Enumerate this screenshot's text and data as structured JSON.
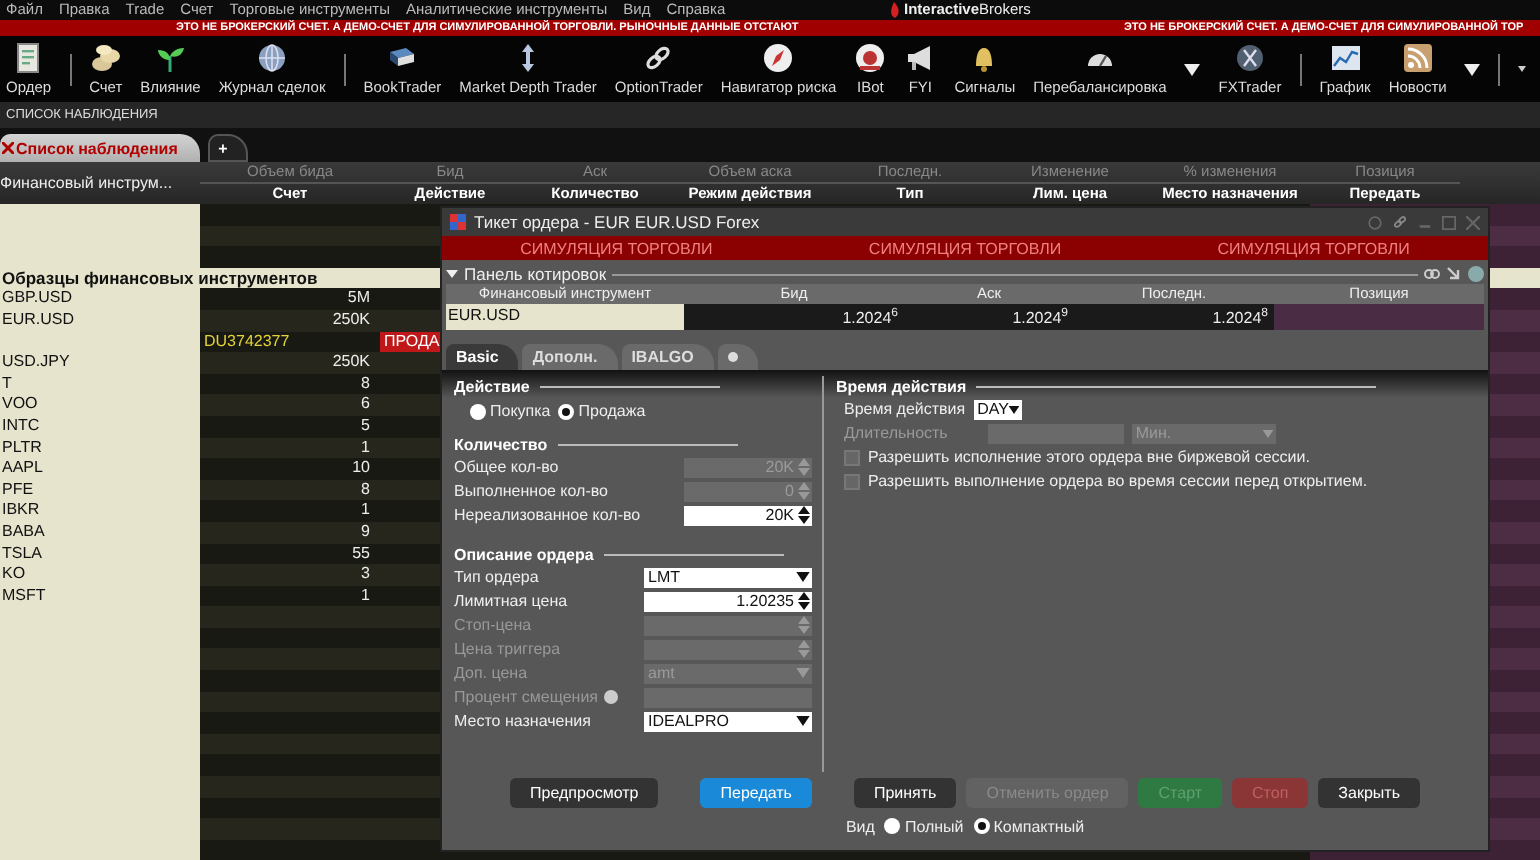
{
  "menu": [
    "Файл",
    "Правка",
    "Trade",
    "Счет",
    "Торговые инструменты",
    "Аналитические инструменты",
    "Вид",
    "Справка"
  ],
  "logo": "**Interactive**Brokers",
  "banner": [
    "ЭТО НЕ БРОКЕРСКИЙ СЧЕТ. А ДЕМО-СЧЕТ ДЛЯ СИМУЛИРОВАННОЙ ТОРГОВЛИ. РЫНОЧНЫЕ ДАННЫЕ ОТСТАЮТ",
    "ЭТО НЕ БРОКЕРСКИЙ СЧЕТ. А ДЕМО-СЧЕТ ДЛЯ СИМУЛИРОВАННОЙ ТОР"
  ],
  "toolbar": [
    {
      "kind": "button",
      "label": "Ордер"
    },
    {
      "kind": "separator"
    },
    {
      "kind": "button",
      "label": "Счет"
    },
    {
      "kind": "button",
      "label": "Влияние"
    },
    {
      "kind": "button",
      "label": "Журнал сделок"
    },
    {
      "kind": "separator"
    },
    {
      "kind": "button",
      "label": "BookTrader"
    },
    {
      "kind": "button",
      "label": "Market Depth Trader"
    },
    {
      "kind": "button",
      "label": "OptionTrader"
    },
    {
      "kind": "button",
      "label": "Навигатор риска"
    },
    {
      "kind": "button",
      "label": "IBot"
    },
    {
      "kind": "button",
      "label": "FYI"
    },
    {
      "kind": "button",
      "label": "Сигналы"
    },
    {
      "kind": "button",
      "label": "Перебалансировка"
    },
    {
      "kind": "dropdown"
    },
    {
      "kind": "button",
      "label": "FXTrader"
    },
    {
      "kind": "separator"
    },
    {
      "kind": "button",
      "label": "График"
    },
    {
      "kind": "button",
      "label": "Новости"
    },
    {
      "kind": "dropdown"
    },
    {
      "kind": "separator"
    },
    {
      "kind": "small_dropdown"
    }
  ],
  "section_title": "СПИСОК НАБЛЮДЕНИЯ",
  "watchlist": {
    "tabs": [
      {
        "label": "Список наблюдения",
        "closable": true,
        "selected": true
      },
      {
        "label": "+",
        "closable": false,
        "selected": false
      }
    ],
    "instrument_header": "Финансовый инструм...",
    "columns": [
      {
        "top": "Объем бида",
        "bottom": "Счет"
      },
      {
        "top": "Бид",
        "bottom": "Действие"
      },
      {
        "top": "Аск",
        "bottom": "Количество"
      },
      {
        "top": "Объем аска",
        "bottom": "Режим действия"
      },
      {
        "top": "Последн.",
        "bottom": "Тип"
      },
      {
        "top": "Изменение",
        "bottom": "Лим. цена"
      },
      {
        "top": "% изменения",
        "bottom": "Место назначения"
      },
      {
        "top": "Позиция",
        "bottom": "Передать"
      }
    ],
    "rows": [
      {
        "kind": "blank"
      },
      {
        "kind": "blank"
      },
      {
        "kind": "blank"
      },
      {
        "kind": "group",
        "label": "Образцы финансовых инструментов"
      },
      {
        "kind": "instrument",
        "symbol": "GBP.USD",
        "bid_size": "5M"
      },
      {
        "kind": "instrument",
        "symbol": "EUR.USD",
        "bid_size": "250K"
      },
      {
        "kind": "order",
        "account": "DU3742377",
        "action": "ПРОДА"
      },
      {
        "kind": "instrument",
        "symbol": "USD.JPY",
        "bid_size": "250K"
      },
      {
        "kind": "instrument",
        "symbol": "T",
        "bid_size": "8"
      },
      {
        "kind": "instrument",
        "symbol": "VOO",
        "bid_size": "6"
      },
      {
        "kind": "instrument",
        "symbol": "INTC",
        "bid_size": "5"
      },
      {
        "kind": "instrument",
        "symbol": "PLTR",
        "bid_size": "1"
      },
      {
        "kind": "instrument",
        "symbol": "AAPL",
        "bid_size": "10"
      },
      {
        "kind": "instrument",
        "symbol": "PFE",
        "bid_size": "8"
      },
      {
        "kind": "instrument",
        "symbol": "IBKR",
        "bid_size": "1"
      },
      {
        "kind": "instrument",
        "symbol": "BABA",
        "bid_size": "9"
      },
      {
        "kind": "instrument",
        "symbol": "TSLA",
        "bid_size": "55"
      },
      {
        "kind": "instrument",
        "symbol": "KO",
        "bid_size": "3"
      },
      {
        "kind": "instrument",
        "symbol": "MSFT",
        "bid_size": "1"
      }
    ]
  },
  "order_ticket": {
    "title": "Тикет ордера - EUR EUR.USD Forex",
    "simulation_labels": [
      "СИМУЛЯЦИЯ ТОРГОВЛИ",
      "СИМУЛЯЦИЯ ТОРГОВЛИ",
      "СИМУЛЯЦИЯ ТОРГОВЛИ"
    ],
    "quote_panel": {
      "title": "Панель котировок",
      "expanded": true,
      "columns": [
        "Финансовый инструмент",
        "Бид",
        "Аск",
        "Последн.",
        "Позиция"
      ],
      "row": {
        "instrument": "EUR.USD",
        "bid": "1.2024$^{6}$",
        "ask": "1.2024$^{9}$",
        "last": "1.2024$^{8}$"
      }
    },
    "tabs": [
      {
        "kind": "text",
        "label": "Basic",
        "selected": true
      },
      {
        "kind": "text",
        "label": "Дополн.",
        "selected": false
      },
      {
        "kind": "text",
        "label": "IBALGO",
        "selected": false
      },
      {
        "kind": "icon",
        "selected": false
      }
    ],
    "action": {
      "title": "Действие",
      "options": [
        {
          "label": "Покупка",
          "selected": false
        },
        {
          "label": "Продажа",
          "selected": true
        }
      ]
    },
    "quantity": {
      "title": "Количество",
      "fields": [
        {
          "label": "Общее кол-во",
          "value": "20K",
          "disabled": true
        },
        {
          "label": "Выполненное кол-во",
          "value": "0",
          "disabled": true
        },
        {
          "label": "Нереализованное кол-во",
          "value": "20K",
          "disabled": false
        }
      ]
    },
    "order_description": {
      "title": "Описание ордера",
      "fields": [
        {
          "kind": "select",
          "label": "Тип ордера",
          "value": "LMT",
          "disabled": false
        },
        {
          "kind": "spinner",
          "label": "Лимитная цена",
          "value": "1.20235",
          "disabled": false
        },
        {
          "kind": "spinner",
          "label": "Стоп-цена",
          "disabled": true
        },
        {
          "kind": "spinner",
          "label": "Цена триггера",
          "disabled": true
        },
        {
          "kind": "select",
          "label": "Доп. цена",
          "value": "amt",
          "disabled": true
        },
        {
          "kind": "percent",
          "label": "Процент смещения",
          "disabled": true
        },
        {
          "kind": "select",
          "label": "Место назначения",
          "value": "IDEALPRO",
          "disabled": false
        }
      ]
    },
    "time_in_force": {
      "title": "Время действия",
      "tif": {
        "label": "Время действия",
        "value": "DAY"
      },
      "duration": {
        "label": "Длительность",
        "unit": "Мин.",
        "disabled": true
      },
      "options": [
        {
          "label": "Разрешить исполнение этого ордера вне биржевой сессии.",
          "checked": false
        },
        {
          "label": "Разрешить выполнение ордера во время сессии перед открытием.",
          "checked": false
        }
      ]
    },
    "buttons": [
      {
        "kind": "default",
        "label": "Предпросмотр",
        "disabled": false
      },
      {
        "kind": "primary",
        "label": "Передать",
        "disabled": false
      },
      {
        "kind": "default",
        "label": "Принять",
        "disabled": false
      },
      {
        "kind": "default",
        "label": "Отменить ордер",
        "disabled": true
      },
      {
        "kind": "success",
        "label": "Старт",
        "disabled": true
      },
      {
        "kind": "danger",
        "label": "Стоп",
        "disabled": true
      },
      {
        "kind": "default",
        "label": "Закрыть",
        "disabled": false
      }
    ],
    "view": {
      "label": "Вид",
      "options": [
        {
          "label": "Полный",
          "selected": false
        },
        {
          "label": "Компактный",
          "selected": true
        }
      ]
    }
  }
}
